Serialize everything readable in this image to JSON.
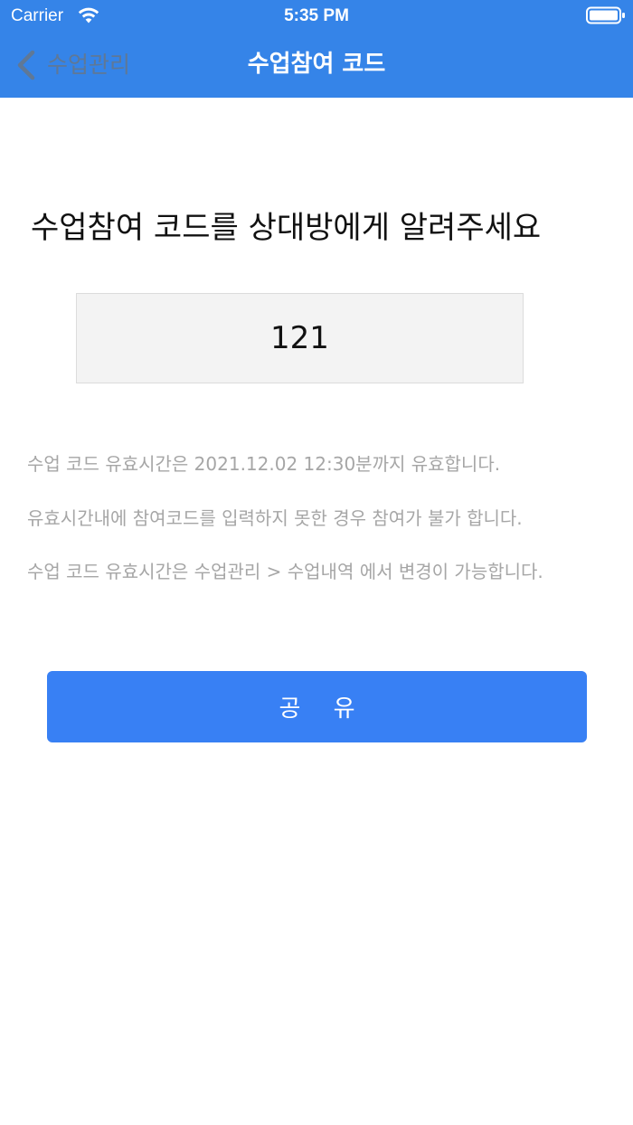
{
  "status_bar": {
    "carrier": "Carrier",
    "time": "5:35 PM",
    "wifi_icon": "wifi-icon",
    "battery_icon": "battery-icon"
  },
  "nav": {
    "back_label": "수업관리",
    "back_icon": "chevron-left-icon",
    "title": "수업참여 코드"
  },
  "main": {
    "headline": "수업참여 코드를 상대방에게 알려주세요",
    "code": "121",
    "notices": [
      "수업 코드 유효시간은 2021.12.02 12:30분까지 유효합니다.",
      "유효시간내에 참여코드를 입력하지 못한 경우 참여가 불가 합니다.",
      "수업 코드 유효시간은 수업관리  >  수업내역 에서 변경이 가능합니다."
    ],
    "share_label": "공 유"
  },
  "colors": {
    "header": "#3584e8",
    "share_button": "#3880f4",
    "notice_text": "#a6a6a6",
    "code_box": "#f3f3f3"
  }
}
